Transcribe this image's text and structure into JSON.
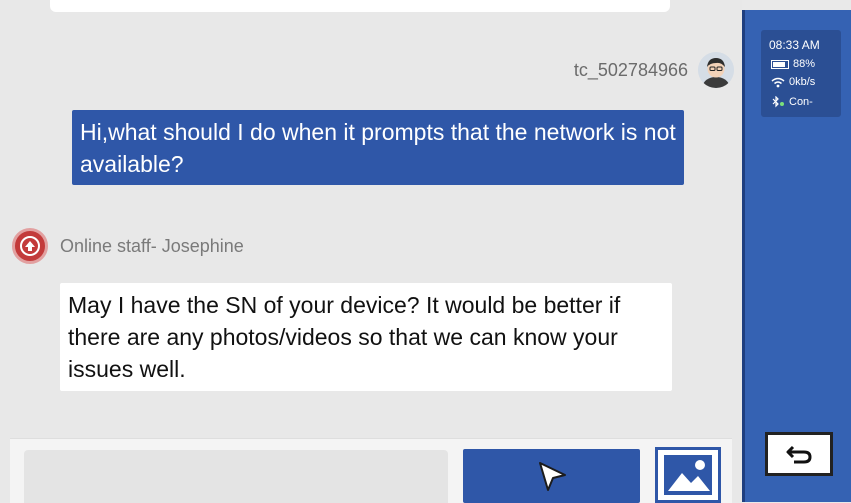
{
  "chat": {
    "user": {
      "name": "tc_502784966",
      "message": "Hi,what should I do when it prompts that the network is not available?"
    },
    "staff": {
      "name": "Online staff- Josephine",
      "message": "May I have the SN of your device? It would be better if there are any photos/videos so that we can know your issues well."
    }
  },
  "input": {
    "value": "",
    "placeholder": ""
  },
  "icons": {
    "send": "send-arrow-icon",
    "image": "image-icon",
    "back": "back-arrow-icon",
    "battery": "battery-icon",
    "wifi": "wifi-icon",
    "bluetooth": "bluetooth-icon"
  },
  "status": {
    "time": "08:33 AM",
    "battery": "88%",
    "speed": "0kb/s",
    "connection": "Con-"
  },
  "colors": {
    "accent": "#2f57a8",
    "panel": "#3562b3",
    "background": "#e8e8e8"
  }
}
